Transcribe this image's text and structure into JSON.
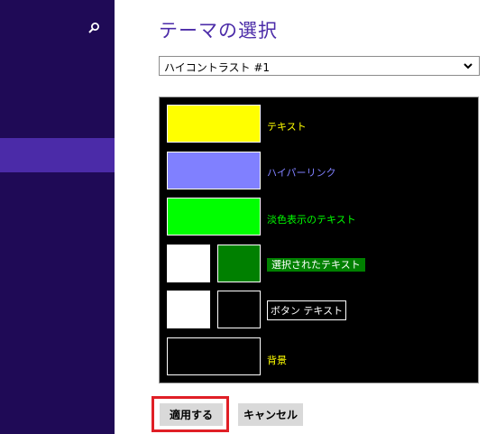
{
  "page": {
    "title": "テーマの選択"
  },
  "theme_select": {
    "value": "ハイコントラスト #1",
    "icon": "chevron-down-icon"
  },
  "sidebar": {
    "search_icon": "search-icon"
  },
  "preview": {
    "background_color": "#000000",
    "items": {
      "text": {
        "label": "テキスト",
        "swatch_color": "#ffff00",
        "label_color": "#ffff00"
      },
      "hyperlink": {
        "label": "ハイパーリンク",
        "swatch_color": "#8080ff",
        "label_color": "#8080ff"
      },
      "disabled_text": {
        "label": "淡色表示のテキスト",
        "swatch_color": "#00ff00",
        "label_color": "#00ff00"
      },
      "selected_text": {
        "label": "選択されたテキスト",
        "swatch_fg_color": "#ffffff",
        "swatch_bg_color": "#008000"
      },
      "button_text": {
        "label": "ボタン テキスト",
        "swatch_fg_color": "#ffffff",
        "swatch_bg_color": "#000000"
      },
      "background": {
        "label": "背景",
        "swatch_color": "#000000",
        "label_color": "#ffff00"
      }
    }
  },
  "buttons": {
    "apply": "適用する",
    "cancel": "キャンセル"
  },
  "colors": {
    "sidebar_bg": "#1f0a56",
    "sidebar_highlight": "#4b2ba8",
    "accent": "#4b2ba8",
    "highlight_frame": "#e01f26"
  }
}
